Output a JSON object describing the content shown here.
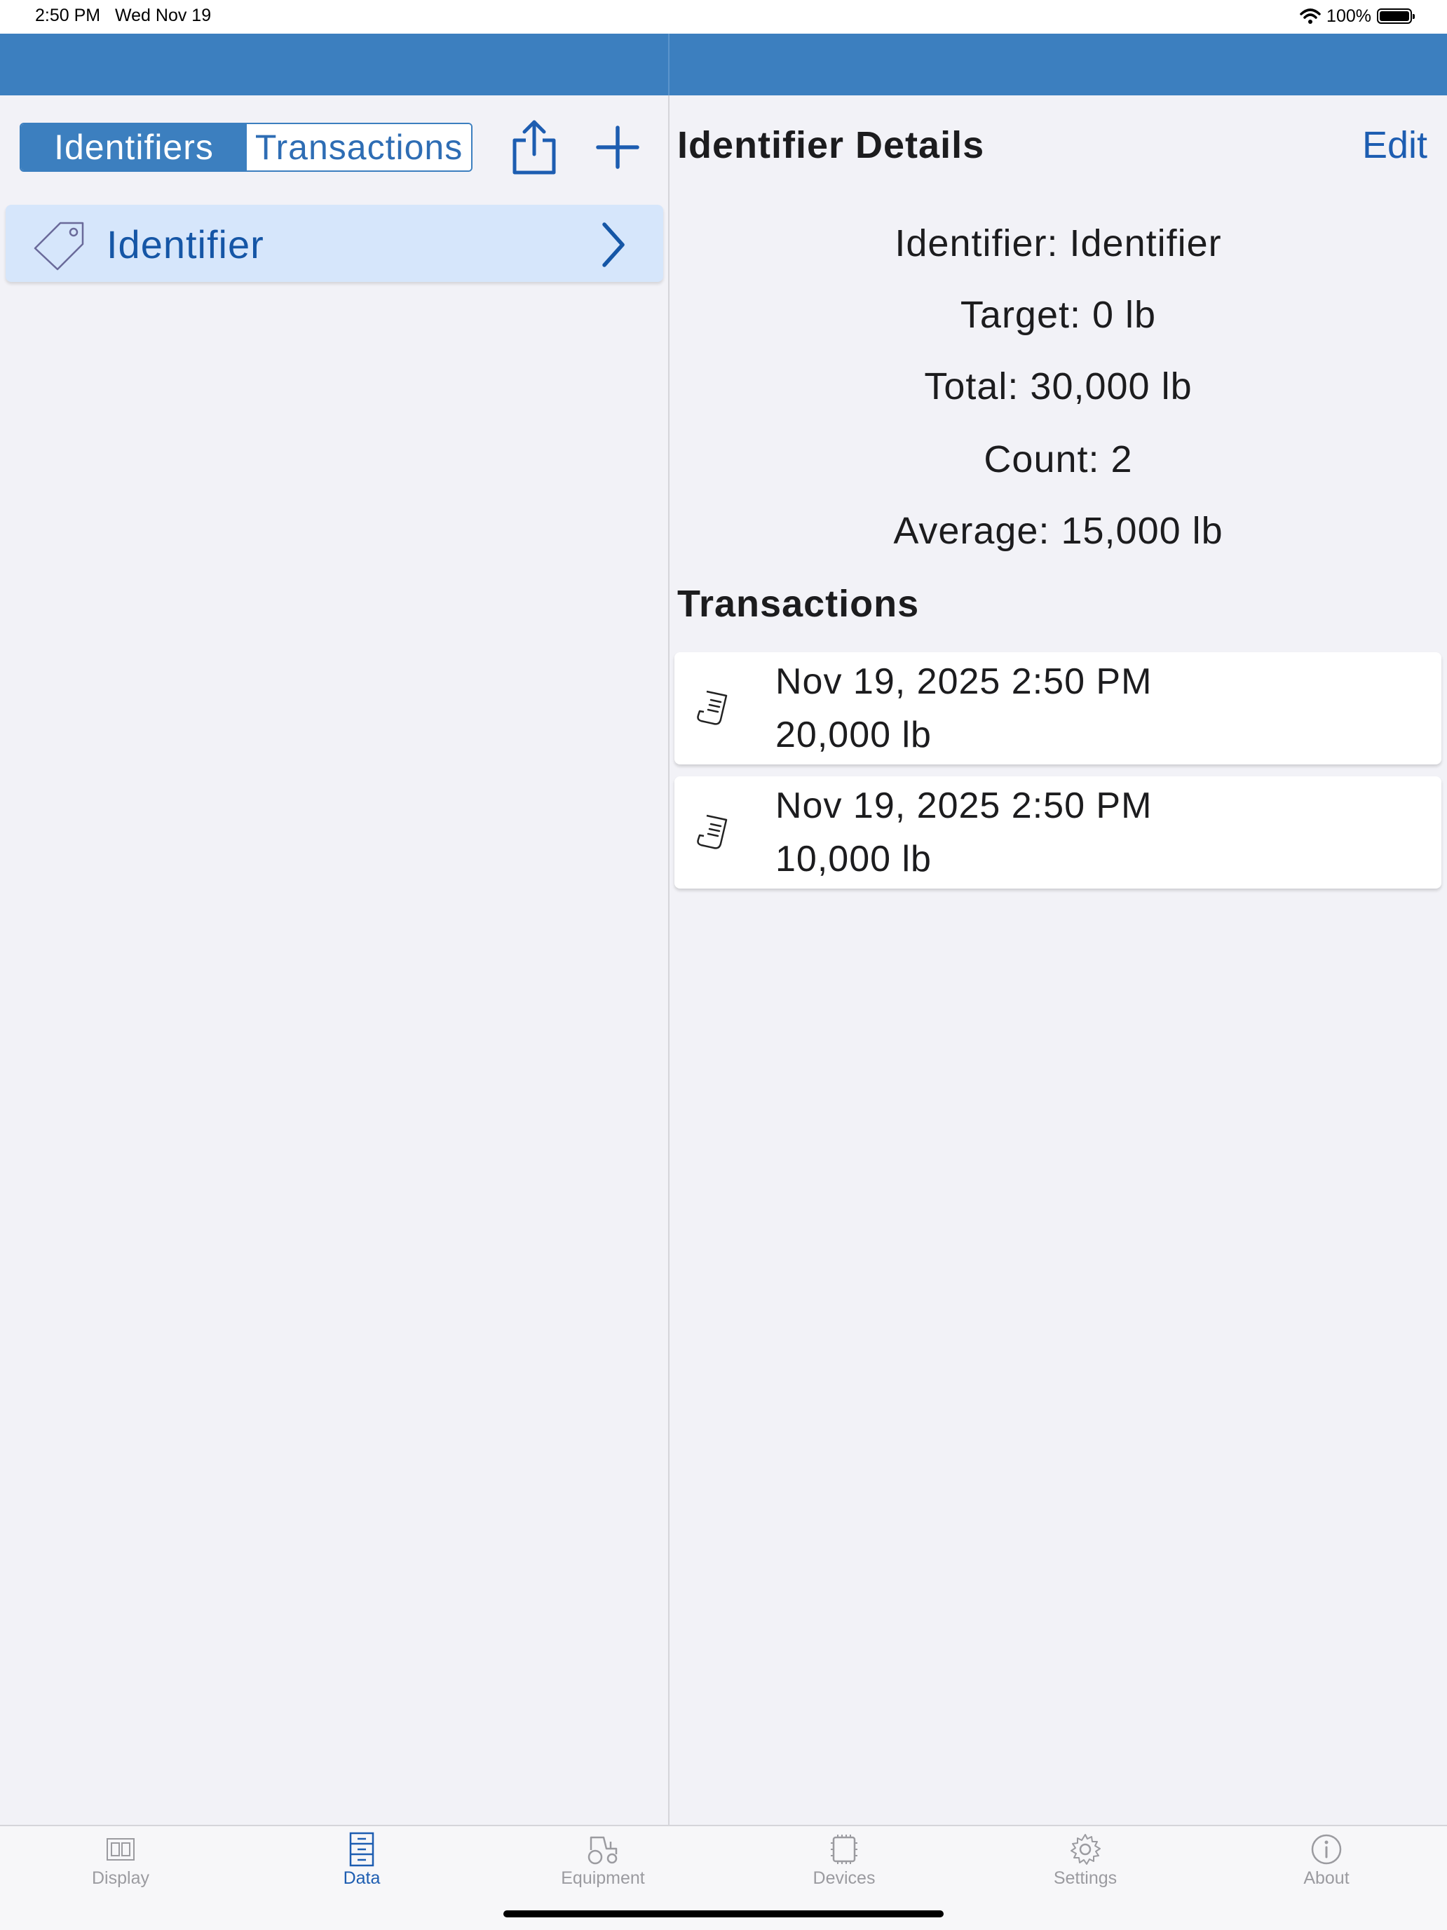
{
  "status": {
    "time": "2:50 PM",
    "date": "Wed Nov 19",
    "battery": "100%"
  },
  "left": {
    "segments": [
      "Identifiers",
      "Transactions"
    ],
    "active_segment": "Identifiers",
    "identifiers": [
      {
        "label": "Identifier"
      }
    ]
  },
  "detail": {
    "title": "Identifier Details",
    "edit_label": "Edit",
    "identifier": "Identifier: Identifier",
    "target": "Target: 0 lb",
    "total": "Total: 30,000 lb",
    "count": "Count: 2",
    "average": "Average: 15,000 lb",
    "transactions_heading": "Transactions",
    "transactions": [
      {
        "date": "Nov 19, 2025 2:50 PM",
        "amount": "20,000 lb"
      },
      {
        "date": "Nov 19, 2025 2:50 PM",
        "amount": "10,000 lb"
      }
    ]
  },
  "tabs": [
    {
      "label": "Display",
      "icon": "display-icon"
    },
    {
      "label": "Data",
      "icon": "data-icon"
    },
    {
      "label": "Equipment",
      "icon": "tractor-icon"
    },
    {
      "label": "Devices",
      "icon": "chip-icon"
    },
    {
      "label": "Settings",
      "icon": "gear-icon"
    },
    {
      "label": "About",
      "icon": "info-icon"
    }
  ],
  "active_tab": "Data",
  "colors": {
    "nav_blue": "#3c7fbf",
    "accent": "#1d5db1",
    "selected_row": "#d6e6fb",
    "background": "#f2f2f7"
  }
}
